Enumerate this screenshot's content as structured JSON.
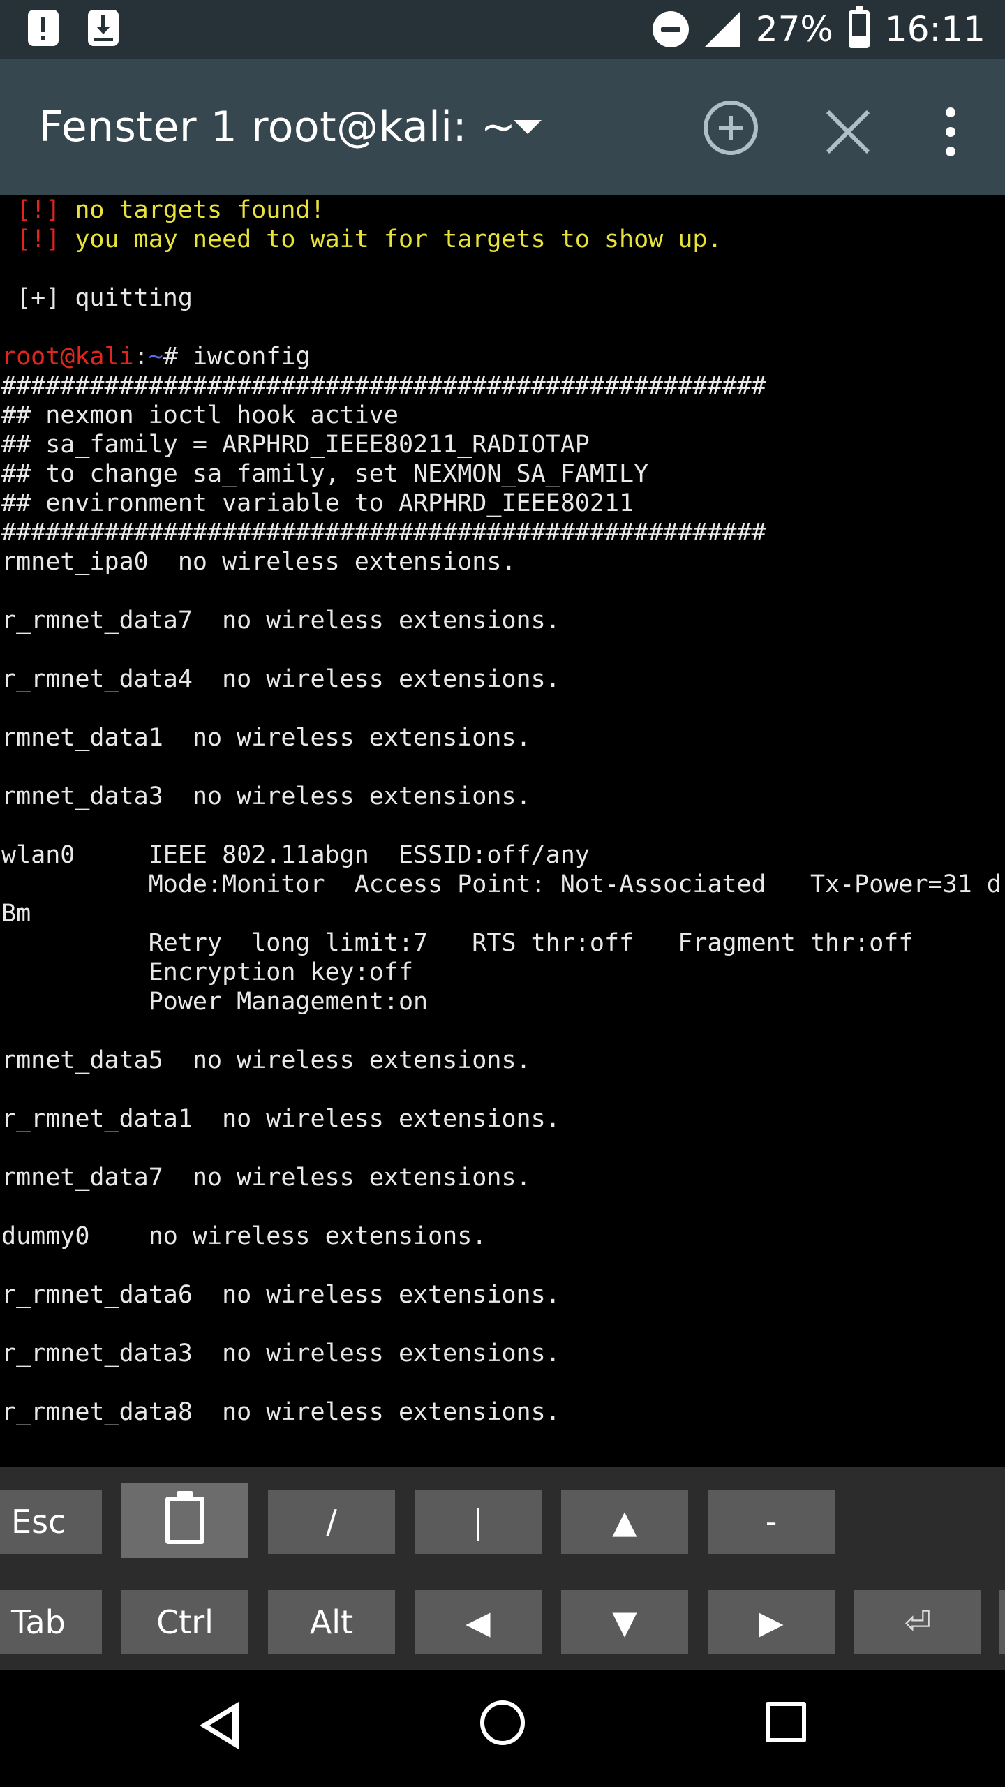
{
  "status_bar": {
    "battery_text": "27%",
    "battery_level": 0.27,
    "time": "16:11"
  },
  "app_bar": {
    "title": "Fenster 1 root@kali: ~"
  },
  "terminal": {
    "lines": [
      [
        {
          "t": " [!] ",
          "c": "red"
        },
        {
          "t": "no targets found!",
          "c": "yellow"
        }
      ],
      [
        {
          "t": " [!] ",
          "c": "red"
        },
        {
          "t": "you may need to wait for targets to show up.",
          "c": "yellow"
        }
      ],
      [],
      [
        {
          "t": " [+] quitting",
          "c": "white"
        }
      ],
      [],
      [
        {
          "t": "root@kali",
          "c": "red"
        },
        {
          "t": ":",
          "c": "white"
        },
        {
          "t": "~",
          "c": "blue"
        },
        {
          "t": "# iwconfig",
          "c": "white"
        }
      ],
      [
        {
          "t": "####################################################",
          "c": "white"
        }
      ],
      [
        {
          "t": "## nexmon ioctl hook active",
          "c": "white"
        }
      ],
      [
        {
          "t": "## sa_family = ARPHRD_IEEE80211_RADIOTAP",
          "c": "white"
        }
      ],
      [
        {
          "t": "## to change sa_family, set NEXMON_SA_FAMILY",
          "c": "white"
        }
      ],
      [
        {
          "t": "## environment variable to ARPHRD_IEEE80211",
          "c": "white"
        }
      ],
      [
        {
          "t": "####################################################",
          "c": "white"
        }
      ],
      [
        {
          "t": "rmnet_ipa0  no wireless extensions.",
          "c": "white"
        }
      ],
      [],
      [
        {
          "t": "r_rmnet_data7  no wireless extensions.",
          "c": "white"
        }
      ],
      [],
      [
        {
          "t": "r_rmnet_data4  no wireless extensions.",
          "c": "white"
        }
      ],
      [],
      [
        {
          "t": "rmnet_data1  no wireless extensions.",
          "c": "white"
        }
      ],
      [],
      [
        {
          "t": "rmnet_data3  no wireless extensions.",
          "c": "white"
        }
      ],
      [],
      [
        {
          "t": "wlan0     IEEE 802.11abgn  ESSID:off/any",
          "c": "white"
        }
      ],
      [
        {
          "t": "          Mode:Monitor  Access Point: Not-Associated   Tx-Power=31 d",
          "c": "white"
        }
      ],
      [
        {
          "t": "Bm",
          "c": "white"
        }
      ],
      [
        {
          "t": "          Retry  long limit:7   RTS thr:off   Fragment thr:off",
          "c": "white"
        }
      ],
      [
        {
          "t": "          Encryption key:off",
          "c": "white"
        }
      ],
      [
        {
          "t": "          Power Management:on",
          "c": "white"
        }
      ],
      [],
      [
        {
          "t": "rmnet_data5  no wireless extensions.",
          "c": "white"
        }
      ],
      [],
      [
        {
          "t": "r_rmnet_data1  no wireless extensions.",
          "c": "white"
        }
      ],
      [],
      [
        {
          "t": "rmnet_data7  no wireless extensions.",
          "c": "white"
        }
      ],
      [],
      [
        {
          "t": "dummy0    no wireless extensions.",
          "c": "white"
        }
      ],
      [],
      [
        {
          "t": "r_rmnet_data6  no wireless extensions.",
          "c": "white"
        }
      ],
      [],
      [
        {
          "t": "r_rmnet_data3  no wireless extensions.",
          "c": "white"
        }
      ],
      [],
      [
        {
          "t": "r_rmnet_data8  no wireless extensions.",
          "c": "white"
        }
      ]
    ]
  },
  "extra_keys": {
    "row1": {
      "esc": "Esc",
      "slash": "/",
      "pipe": "|",
      "up": "▲",
      "dash": "-"
    },
    "row2": {
      "tab": "Tab",
      "ctrl": "Ctrl",
      "alt": "Alt",
      "left": "◀",
      "down": "▼",
      "right": "▶",
      "enter": "⏎"
    }
  },
  "colors": {
    "status_bar": "#263238",
    "app_bar": "#37474f",
    "prompt_user": "#e0261f",
    "prompt_path": "#5a6ce8",
    "warning_text": "#e8e33a",
    "key_background": "#5b5b5b"
  },
  "icons": [
    "notification-alert-icon",
    "download-icon",
    "do-not-disturb-icon",
    "signal-icon",
    "battery-icon",
    "dropdown-caret-icon",
    "add-session-icon",
    "close-icon",
    "more-vert-icon",
    "clipboard-icon",
    "nav-back-icon",
    "nav-home-icon",
    "nav-recents-icon"
  ]
}
